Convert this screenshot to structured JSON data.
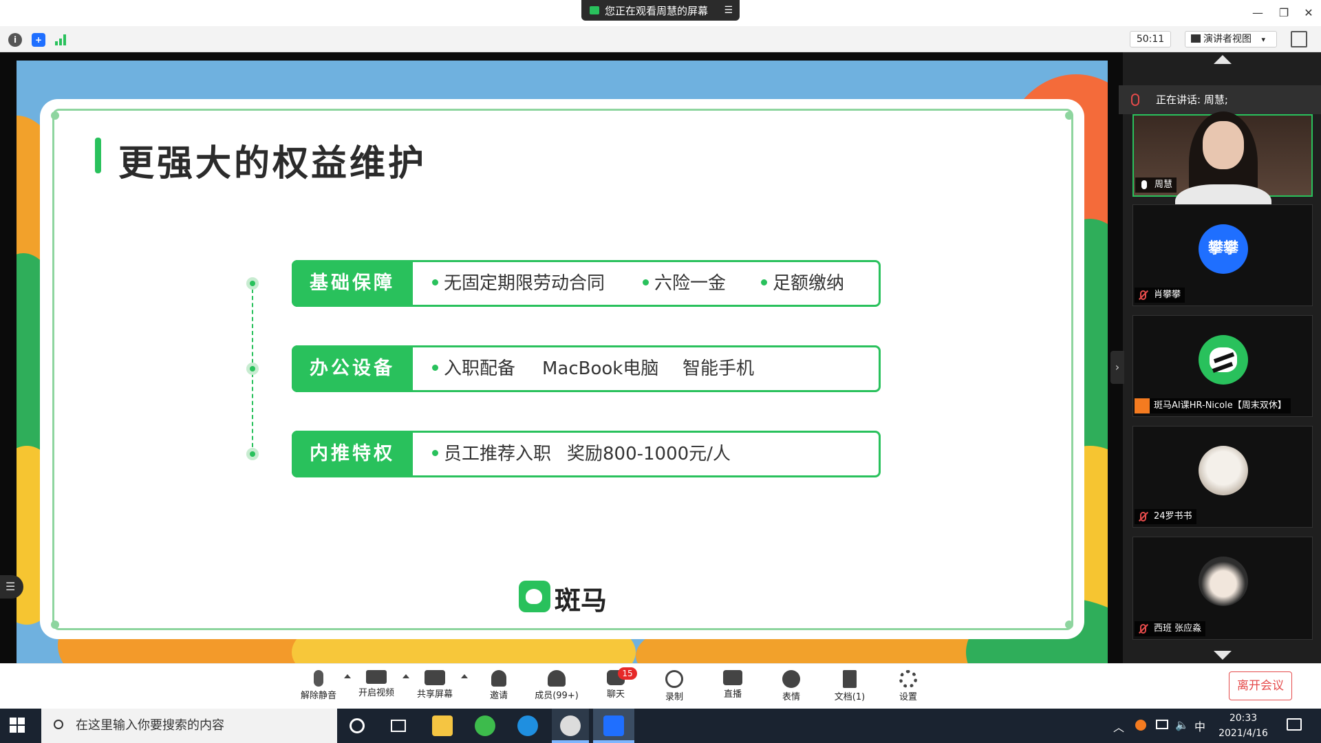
{
  "window": {
    "share_status": "您正在观看周慧的屏幕",
    "min": "—",
    "restore": "❐",
    "close": "✕"
  },
  "infobar": {
    "timer": "50:11",
    "view_mode": "演讲者视图",
    "view_caret": "▾"
  },
  "slide": {
    "title": "更强大的权益维护",
    "rows": [
      {
        "tag": "基础保障",
        "items": [
          "无固定期限劳动合同",
          "六险一金",
          "足额缴纳"
        ]
      },
      {
        "tag": "办公设备",
        "items": [
          "入职配备",
          "MacBook电脑",
          "智能手机"
        ]
      },
      {
        "tag": "内推特权",
        "items": [
          "员工推荐入职",
          "奖励800-1000元/人"
        ]
      }
    ],
    "brand": "斑马"
  },
  "gallery": {
    "talking": "正在讲话: 周慧;",
    "participants": [
      {
        "name": "周慧",
        "muted": false
      },
      {
        "name": "肖攀攀",
        "avatar_text": "攀攀",
        "muted": true
      },
      {
        "name": "斑马AI课HR-Nicole【周末双休】",
        "muted": false
      },
      {
        "name": "24罗书书",
        "muted": true
      },
      {
        "name": "西班 张应淼",
        "muted": true
      }
    ]
  },
  "toolbar": {
    "unmute": "解除静音",
    "start_video": "开启视频",
    "share_screen": "共享屏幕",
    "invite": "邀请",
    "members": "成员(99+)",
    "chat": "聊天",
    "chat_badge": "15",
    "record": "录制",
    "live": "直播",
    "reactions": "表情",
    "docs": "文档(1)",
    "settings": "设置",
    "leave": "离开会议"
  },
  "taskbar": {
    "search_placeholder": "在这里输入你要搜索的内容",
    "ime": "中",
    "time": "20:33",
    "date": "2021/4/16"
  },
  "colors": {
    "accent_green": "#29c15c",
    "leave_red": "#e54b4b",
    "avatar_blue": "#1f6fff"
  }
}
